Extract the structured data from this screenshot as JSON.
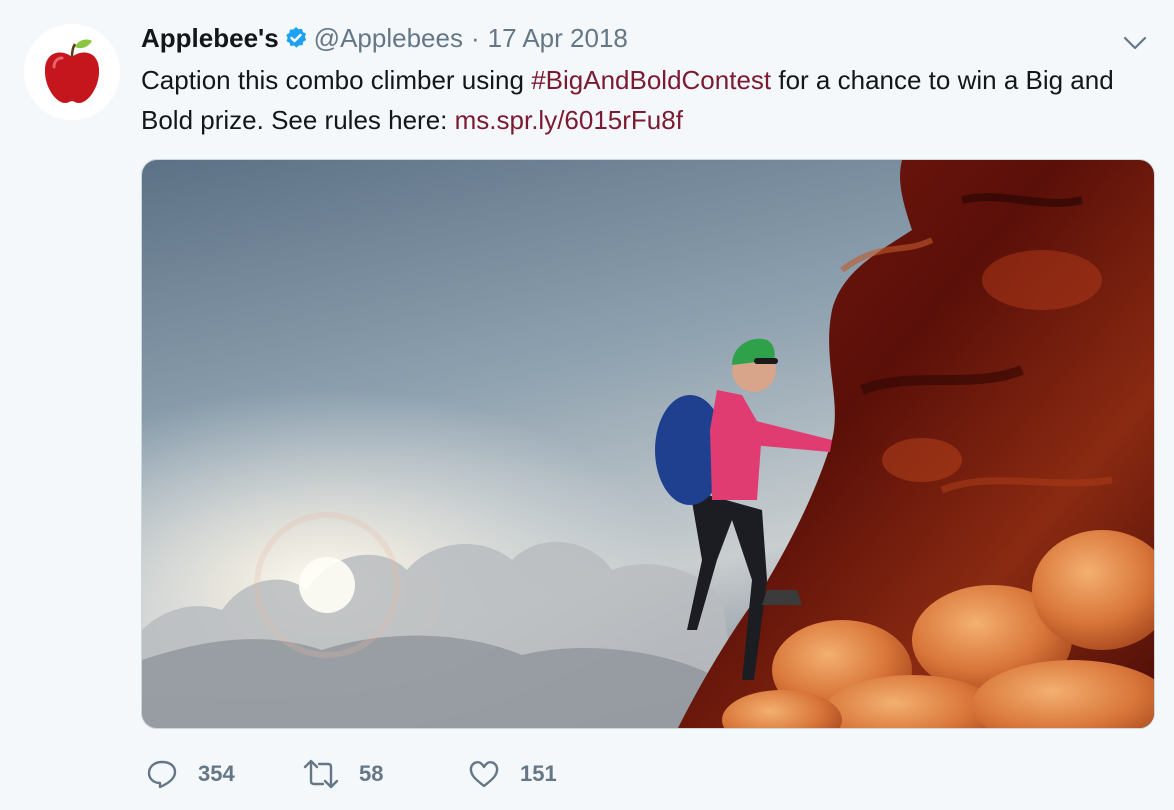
{
  "tweet": {
    "author_name": "Applebee's",
    "author_handle": "@Applebees",
    "separator": "·",
    "date": "17 Apr 2018",
    "text_before": "Caption this combo climber using ",
    "hashtag": "#BigAndBoldContest",
    "text_middle": " for a chance to win a Big and Bold prize. See rules here: ",
    "link": "ms.spr.ly/6015rFu8f",
    "media_alt": "Climber scaling a wall of saucy ribs and fried shrimp"
  },
  "stats": {
    "replies": "354",
    "retweets": "58",
    "likes": "151"
  },
  "colors": {
    "background": "#f5f8fa",
    "link": "#7b1a30",
    "muted": "#657786",
    "verified": "#1da1f2",
    "apple_red": "#c4161c",
    "leaf_green": "#8cc63f"
  },
  "icons": [
    "apple-logo-icon",
    "verified-badge-icon",
    "chevron-down-icon",
    "reply-icon",
    "retweet-icon",
    "like-icon"
  ]
}
